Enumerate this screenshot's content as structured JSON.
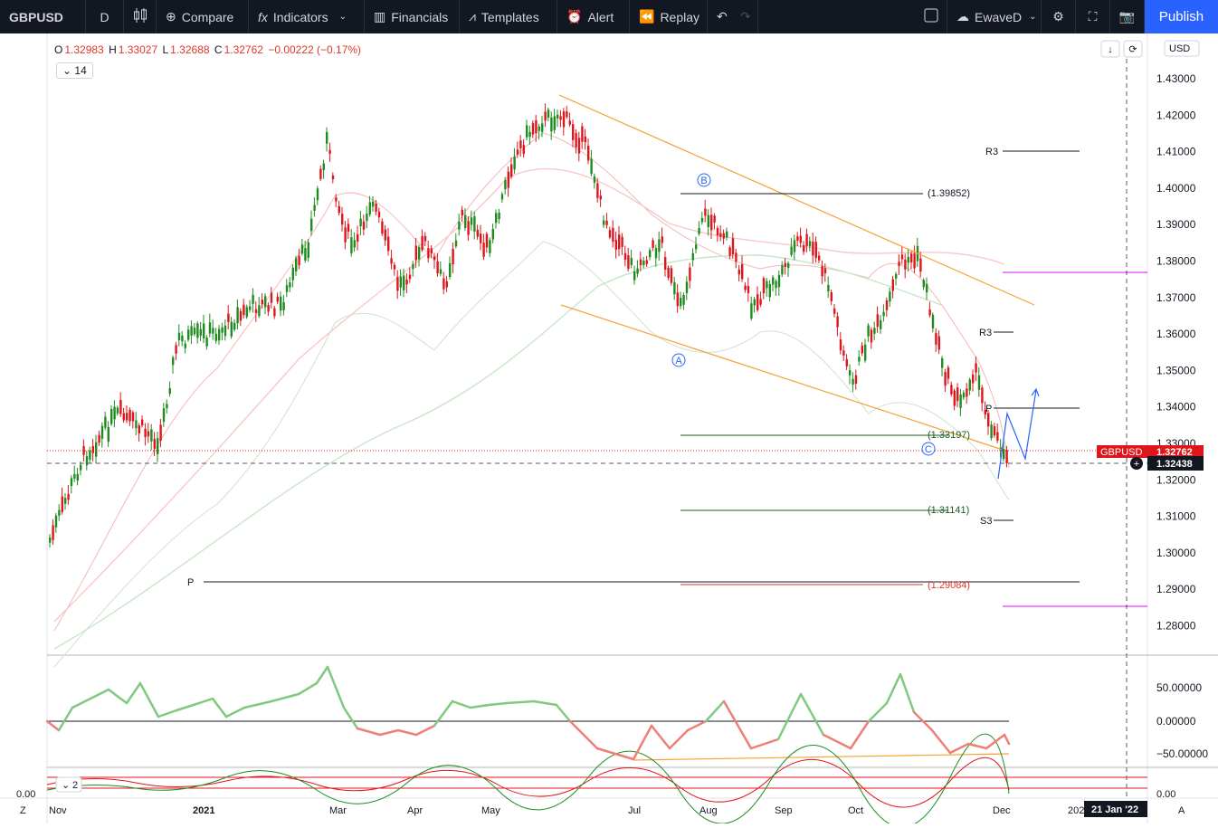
{
  "toolbar": {
    "symbol": "GBPUSD",
    "interval": "D",
    "compare": "Compare",
    "indicators": "Indicators",
    "financials": "Financials",
    "templates": "Templates",
    "alert": "Alert",
    "replay": "Replay",
    "layout_name": "EwaveD",
    "publish": "Publish"
  },
  "legend": {
    "o_label": "O",
    "o": "1.32983",
    "h_label": "H",
    "h": "1.33027",
    "l_label": "L",
    "l": "1.32688",
    "c_label": "C",
    "c": "1.32762",
    "change": "−0.00222 (−0.17%)",
    "indicator_count": "14",
    "sub_indicator_count": "2"
  },
  "price_axis": {
    "currency": "USD",
    "labels": [
      "1.43000",
      "1.42000",
      "1.41000",
      "1.40000",
      "1.39000",
      "1.38000",
      "1.37000",
      "1.36000",
      "1.35000",
      "1.34000",
      "1.33000",
      "1.32000",
      "1.31000",
      "1.30000",
      "1.29000",
      "1.28000"
    ],
    "last_price_symbol": "GBPUSD",
    "last_price": "1.32762",
    "crosshair_price": "1.32438"
  },
  "osc_axis": {
    "labels": [
      "50.00000",
      "0.00000",
      "−50.00000"
    ],
    "sub_labels_left": "0.00",
    "sub_labels_right": "0.00"
  },
  "time_axis": {
    "labels": [
      "Nov",
      "2021",
      "Mar",
      "Apr",
      "May",
      "Jul",
      "Aug",
      "Sep",
      "Oct",
      "Dec",
      "202"
    ],
    "crosshair_date": "21 Jan '22",
    "left_button": "Z",
    "right_button": "A"
  },
  "annotations": {
    "wave_a": "A",
    "wave_b": "B",
    "wave_c": "C",
    "level_1": "(1.39852)",
    "level_2": "(1.33197)",
    "level_3": "(1.31141)",
    "level_4": "(1.29084)",
    "pivot_r3_top": "R3",
    "pivot_r3_mid": "R3",
    "pivot_p_right": "P",
    "pivot_p_left": "P",
    "pivot_s3": "S3"
  },
  "colors": {
    "up": "#26a69a",
    "up_candle": "#1e8c1e",
    "down_candle": "#e0151b",
    "channel": "#f7a135",
    "projection": "#2962ff",
    "magenta": "#e040fb",
    "accent": "#2962ff"
  }
}
